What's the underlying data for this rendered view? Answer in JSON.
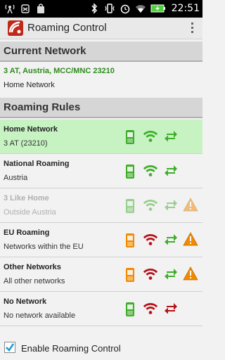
{
  "status_bar": {
    "time": "22:51",
    "left_icons": [
      "wifi-tower-icon",
      "android-bug-icon",
      "shopping-bag-icon"
    ],
    "right_icons": [
      "bluetooth-icon",
      "vibrate-icon",
      "alarm-icon",
      "wifi-icon",
      "battery-icon"
    ]
  },
  "action_bar": {
    "title": "Roaming Control",
    "app_icon": "wifi-shield-icon",
    "overflow_icon": "overflow-menu-icon"
  },
  "current_network": {
    "header": "Current Network",
    "operator_line": "3 AT, Austria, MCC/MNC 23210",
    "network_type": "Home Network"
  },
  "roaming_rules": {
    "header": "Roaming Rules",
    "rules": [
      {
        "title": "Home Network",
        "subtitle": "3 AT (23210)",
        "active": true,
        "disabled": false,
        "phone_color": "green",
        "wifi_color": "green",
        "sync_color": "green",
        "warning": false
      },
      {
        "title": "National Roaming",
        "subtitle": "Austria",
        "active": false,
        "disabled": false,
        "phone_color": "green",
        "wifi_color": "green",
        "sync_color": "green",
        "warning": false
      },
      {
        "title": "3 Like Home",
        "subtitle": "Outside Austria",
        "active": false,
        "disabled": true,
        "phone_color": "green",
        "wifi_color": "green",
        "sync_color": "green",
        "warning": true
      },
      {
        "title": "EU Roaming",
        "subtitle": "Networks within the EU",
        "active": false,
        "disabled": false,
        "phone_color": "orange",
        "wifi_color": "red",
        "sync_color": "green",
        "warning": true
      },
      {
        "title": "Other Networks",
        "subtitle": "All other networks",
        "active": false,
        "disabled": false,
        "phone_color": "orange",
        "wifi_color": "red",
        "sync_color": "green",
        "warning": true
      },
      {
        "title": "No Network",
        "subtitle": "No network available",
        "active": false,
        "disabled": false,
        "phone_color": "green",
        "wifi_color": "red",
        "sync_color": "red",
        "warning": false
      }
    ]
  },
  "enable_checkbox": {
    "label": "Enable Roaming Control",
    "checked": true
  },
  "colors": {
    "green": "#3fae2a",
    "orange": "#f08a00",
    "red": "#b5121b",
    "active_row": "#c7f3c3",
    "warning": "#f08a00"
  }
}
